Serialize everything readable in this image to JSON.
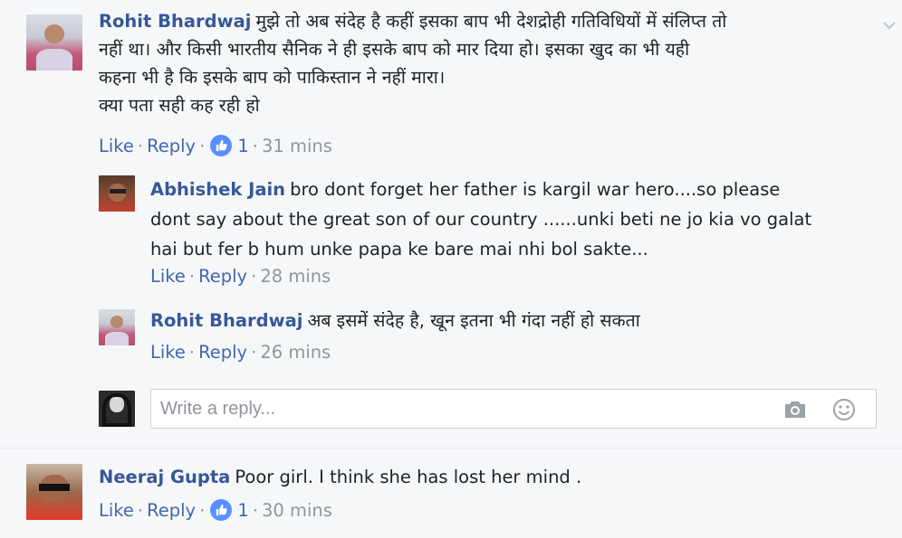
{
  "comments": [
    {
      "author": "Rohit Bhardwaj",
      "text": "मुझे तो अब संदेह है कहीं इसका बाप भी देशद्रोही गतिविधियों में संलिप्त तो\nनहीं था। और किसी भारतीय सैनिक ने ही इसके बाप को मार दिया हो। इसका खुद का भी यही\nकहना भी है कि इसके बाप को पाकिस्तान ने नहीं मारा।\nक्या पता सही कह रही हो",
      "like_label": "Like",
      "reply_label": "Reply",
      "likes": "1",
      "time": "31 mins"
    },
    {
      "author": "Neeraj Gupta",
      "text": "Poor girl. I think she has lost her mind .",
      "like_label": "Like",
      "reply_label": "Reply",
      "likes": "1",
      "time": "30 mins"
    }
  ],
  "replies": [
    {
      "author": "Abhishek Jain",
      "text": "bro dont forget her father is kargil war hero....so please\ndont say about the great son of our country ......unki beti ne jo kia vo galat\nhai but fer b hum unke papa ke bare mai nhi bol sakte...",
      "like_label": "Like",
      "reply_label": "Reply",
      "time": "28 mins"
    },
    {
      "author": "Rohit Bhardwaj",
      "text": "अब इसमें संदेह है, खून इतना भी गंदा नहीं हो सकता",
      "like_label": "Like",
      "reply_label": "Reply",
      "time": "26 mins"
    }
  ],
  "reply_box": {
    "placeholder": "Write a reply..."
  },
  "separator": "·",
  "icons": {
    "options": "chevron-down-icon",
    "like_badge": "thumbs-up-icon",
    "camera": "camera-icon",
    "emoji": "smiley-icon"
  },
  "colors": {
    "author": "#365899",
    "link": "#4267b2",
    "meta": "#90949c",
    "like_badge": "#5890ff"
  }
}
